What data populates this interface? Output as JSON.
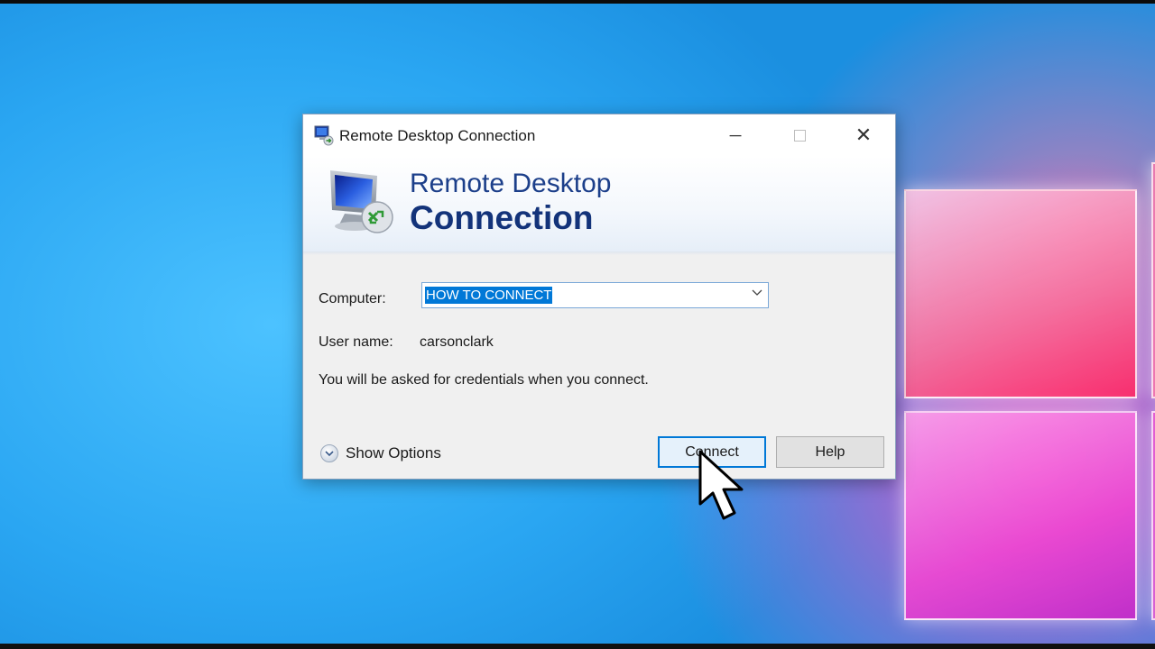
{
  "window": {
    "title": "Remote Desktop Connection",
    "minimize": "─",
    "close": "✕"
  },
  "banner": {
    "line1": "Remote Desktop",
    "line2": "Connection",
    "icon": "remote-desktop-monitor-icon"
  },
  "form": {
    "computer_label": "Computer:",
    "computer_value": "HOW TO CONNECT",
    "username_label": "User name:",
    "username_value": "carsonclark",
    "info": "You will be asked for credentials when you connect."
  },
  "footer": {
    "show_options": "Show Options",
    "connect": "Connect",
    "help": "Help"
  },
  "colors": {
    "accent": "#0078d7",
    "banner_text": "#13337a"
  }
}
